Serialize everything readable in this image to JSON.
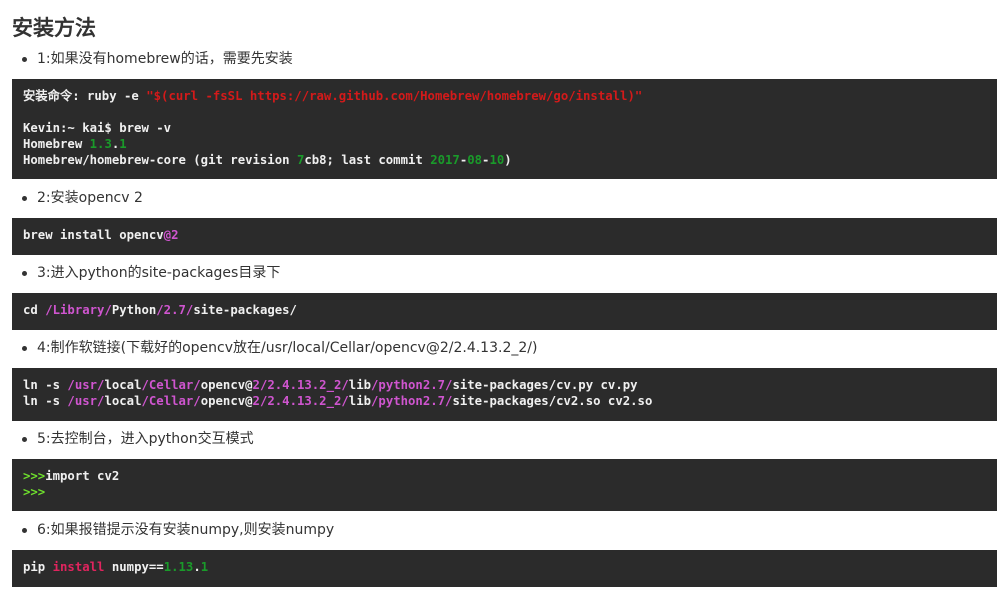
{
  "title": "安装方法",
  "steps": [
    {
      "label": "1:如果没有homebrew的话，需要先安装",
      "lines": [
        [
          {
            "t": "安装命令: ruby -e "
          },
          {
            "t": "\"$(curl -fsSL https://raw.github.com/Homebrew/homebrew/go/install)\"",
            "c": "str"
          }
        ],
        [],
        [
          {
            "t": "Kevin:~ kai$ brew -v"
          }
        ],
        [
          {
            "t": "Homebrew "
          },
          {
            "t": "1.3",
            "c": "num"
          },
          {
            "t": "."
          },
          {
            "t": "1",
            "c": "num"
          }
        ],
        [
          {
            "t": "Homebrew/homebrew-core (git revision "
          },
          {
            "t": "7",
            "c": "num"
          },
          {
            "t": "cb8; last commit "
          },
          {
            "t": "2017",
            "c": "num"
          },
          {
            "t": "-"
          },
          {
            "t": "08",
            "c": "num"
          },
          {
            "t": "-"
          },
          {
            "t": "10",
            "c": "num"
          },
          {
            "t": ")"
          }
        ]
      ]
    },
    {
      "label": "2:安装opencv 2",
      "lines": [
        [
          {
            "t": "brew install opencv"
          },
          {
            "t": "@2",
            "c": "path"
          }
        ]
      ]
    },
    {
      "label": "3:进入python的site-packages目录下",
      "lines": [
        [
          {
            "t": "cd "
          },
          {
            "t": "/Library/",
            "c": "path"
          },
          {
            "t": "Python"
          },
          {
            "t": "/2.7/",
            "c": "path"
          },
          {
            "t": "site-packages/"
          }
        ]
      ]
    },
    {
      "label": "4:制作软链接(下载好的opencv放在/usr/local/Cellar/opencv@2/2.4.13.2_2/)",
      "lines": [
        [
          {
            "t": "ln -s "
          },
          {
            "t": "/usr/",
            "c": "path"
          },
          {
            "t": "local"
          },
          {
            "t": "/Cellar/",
            "c": "path"
          },
          {
            "t": "opencv@"
          },
          {
            "t": "2/2.4.13.2_2/",
            "c": "path"
          },
          {
            "t": "lib"
          },
          {
            "t": "/python2.7/",
            "c": "path"
          },
          {
            "t": "site-packages/cv.py cv.py"
          }
        ],
        [
          {
            "t": "ln -s "
          },
          {
            "t": "/usr/",
            "c": "path"
          },
          {
            "t": "local"
          },
          {
            "t": "/Cellar/",
            "c": "path"
          },
          {
            "t": "opencv@"
          },
          {
            "t": "2/2.4.13.2_2/",
            "c": "path"
          },
          {
            "t": "lib"
          },
          {
            "t": "/python2.7/",
            "c": "path"
          },
          {
            "t": "site-packages/cv2.so cv2.so"
          }
        ]
      ]
    },
    {
      "label": "5:去控制台，进入python交互模式",
      "lines": [
        [
          {
            "t": ">>>",
            "c": "pr"
          },
          {
            "t": "import cv2"
          }
        ],
        [
          {
            "t": ">>>",
            "c": "pr"
          }
        ]
      ]
    },
    {
      "label": "6:如果报错提示没有安装numpy,则安装numpy",
      "lines": [
        [
          {
            "t": "pip "
          },
          {
            "t": "install",
            "c": "kw"
          },
          {
            "t": " numpy=="
          },
          {
            "t": "1.13",
            "c": "num"
          },
          {
            "t": "."
          },
          {
            "t": "1",
            "c": "num"
          }
        ]
      ]
    }
  ]
}
